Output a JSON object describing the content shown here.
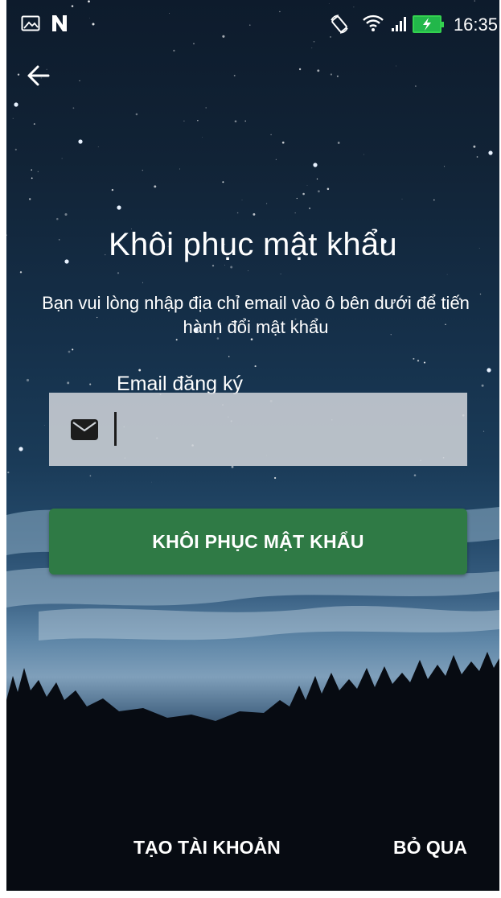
{
  "status_bar": {
    "time": "16:35",
    "icons": [
      "image-icon",
      "n-notification-icon",
      "rotate-icon",
      "wifi-icon",
      "signal-icon",
      "battery-charging-icon"
    ]
  },
  "header": {
    "back_icon": "arrow-left-icon"
  },
  "main": {
    "title": "Khôi phục mật khẩu",
    "subtitle": "Bạn vui lòng nhập địa chỉ email vào ô bên dưới để tiến hành đổi mật khẩu",
    "email_label": "Email đăng ký",
    "email_icon": "mail-icon",
    "email_value": "",
    "email_placeholder": "",
    "recover_button_label": "KHÔI PHỤC MẬT KHẨU"
  },
  "footer": {
    "create_account_label": "TẠO TÀI KHOẢN",
    "skip_label": "BỎ QUA"
  },
  "colors": {
    "button_green": "#2f7a45",
    "input_background": "#cdd2d7",
    "battery_green": "#33d14f",
    "text": "#ffffff"
  }
}
